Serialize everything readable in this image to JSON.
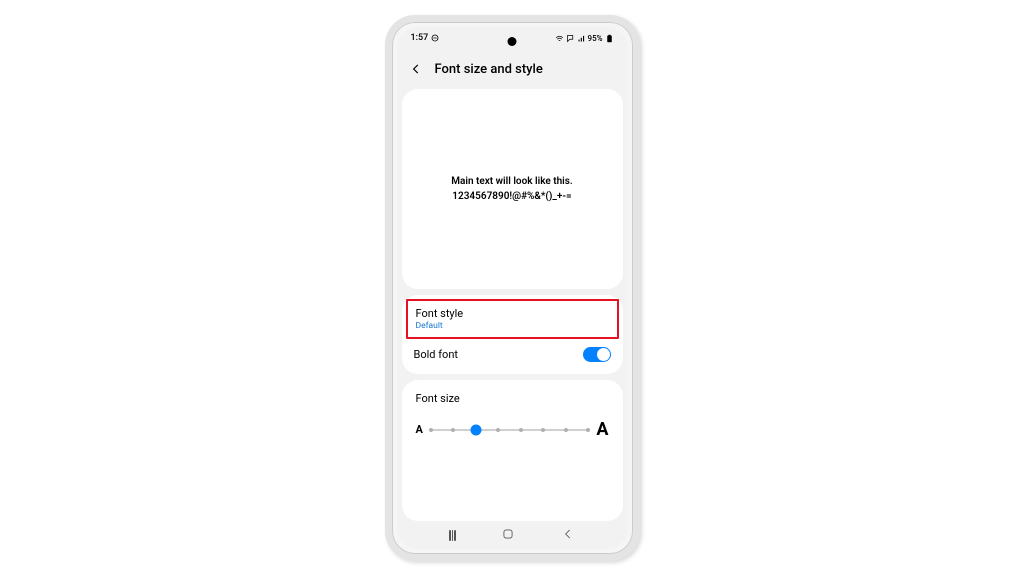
{
  "status": {
    "time": "1:57",
    "battery": "95%"
  },
  "header": {
    "title": "Font size and style"
  },
  "preview": {
    "line1": "Main text will look like this.",
    "line2": "1234567890!@#%&*()_+-="
  },
  "settings": {
    "font_style": {
      "label": "Font style",
      "value": "Default"
    },
    "bold_font": {
      "label": "Bold font",
      "enabled": true
    }
  },
  "size": {
    "label": "Font size",
    "small_glyph": "A",
    "large_glyph": "A",
    "steps": 8,
    "current": 2
  },
  "nav": {
    "recents": "recents",
    "home": "home",
    "back": "back"
  }
}
